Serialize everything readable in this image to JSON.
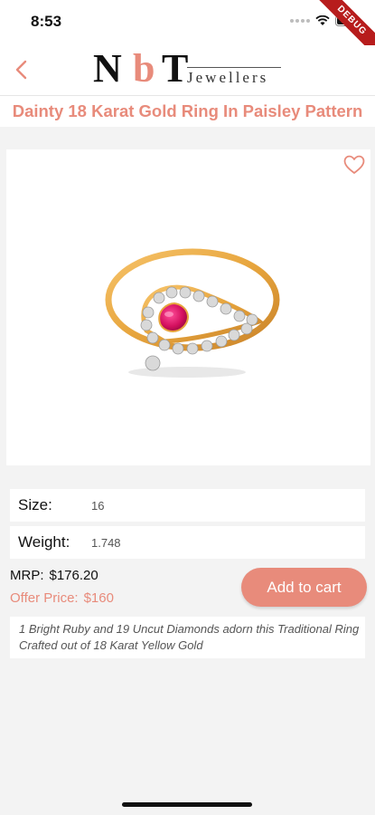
{
  "status_bar": {
    "time": "8:53",
    "debug_label": "DEBUG"
  },
  "app_bar": {
    "back_icon": "chevron-left-icon",
    "logo": {
      "part1": "N",
      "part2": "b",
      "part3": "T",
      "subtitle": "Jewellers"
    }
  },
  "product": {
    "title": "Dainty 18 Karat Gold Ring In Paisley Pattern",
    "favorite_icon": "heart-outline-icon",
    "details": [
      {
        "label": "Size:",
        "value": "16"
      },
      {
        "label": "Weight:",
        "value": "1.748"
      }
    ],
    "mrp_label": "MRP:",
    "mrp_value": "$176.20",
    "offer_label": "Offer Price:",
    "offer_value": "$160",
    "add_to_cart_label": "Add to cart",
    "description": "1 Bright Ruby and 19 Uncut Diamonds adorn this Traditional Ring Crafted out of 18 Karat Yellow Gold"
  },
  "colors": {
    "accent": "#e88b7b",
    "background": "#f3f3f3",
    "card": "#ffffff"
  }
}
